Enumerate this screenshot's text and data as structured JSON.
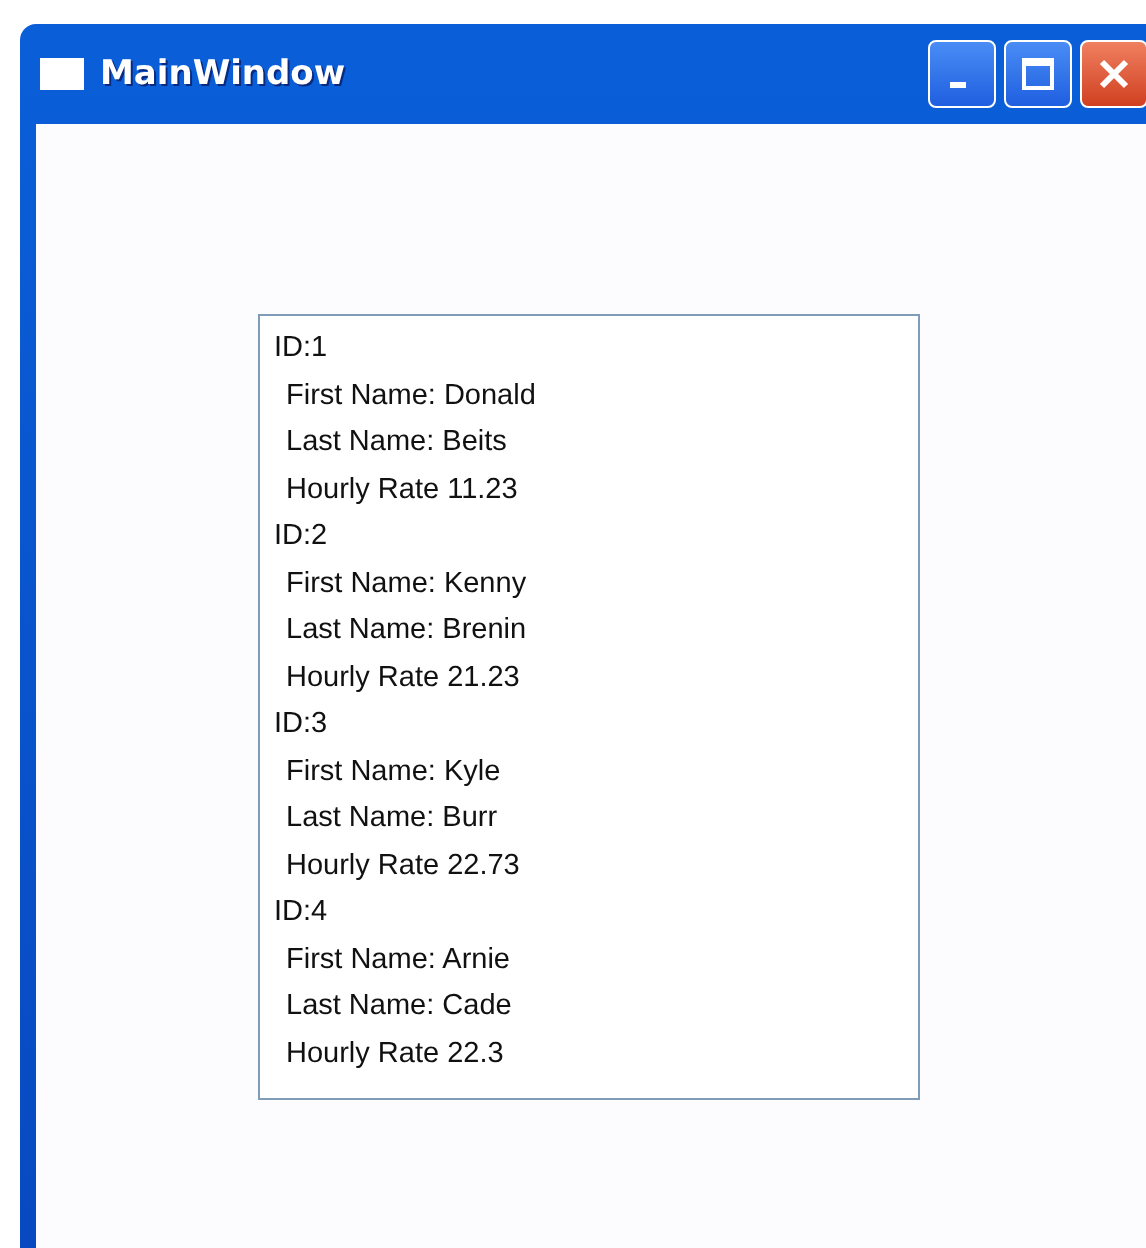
{
  "window": {
    "title": "MainWindow"
  },
  "list": {
    "records": [
      {
        "id": "ID:1",
        "lines": [
          "First Name: Donald",
          "Last Name: Beits",
          "Hourly Rate 11.23"
        ]
      },
      {
        "id": "ID:2",
        "lines": [
          "First Name: Kenny",
          "Last Name: Brenin",
          "Hourly Rate 21.23"
        ]
      },
      {
        "id": "ID:3",
        "lines": [
          "First Name: Kyle",
          "Last Name: Burr",
          "Hourly Rate 22.73"
        ]
      },
      {
        "id": "ID:4",
        "lines": [
          "First Name: Arnie",
          "Last Name: Cade",
          "Hourly Rate 22.3"
        ]
      }
    ]
  }
}
